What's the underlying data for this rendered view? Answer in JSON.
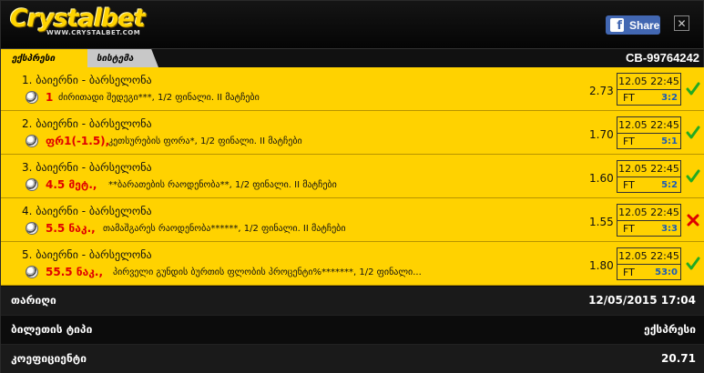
{
  "header": {
    "logo_text": "Crystalbet",
    "logo_sub": "WWW.CRYSTALBET.COM",
    "share_icon": "f",
    "share_label": "Share",
    "close_symbol": "✕"
  },
  "tabs": {
    "express_label": "ექსპრესი",
    "system_label": "სისტემა",
    "ticket_id": "CB-99764242"
  },
  "colors": {
    "accent": "#ffd200",
    "pick_red": "#e00000",
    "score_blue": "#1a5cb8",
    "win_green": "#22aa22",
    "loss_red": "#dd0000"
  },
  "bets": [
    {
      "title": "1. ბაიერნი - ბარსელონა",
      "pick": "1",
      "desc": "ძირითადი შედეგი***, 1/2 ფინალი. II მატჩები",
      "odds": "2.73",
      "date": "12.05 22:45",
      "ft": "FT",
      "score": "3:2",
      "status": "won"
    },
    {
      "title": "2. ბაიერნი - ბარსელონა",
      "pick": "ფრ1(-1.5),",
      "desc": "კეთსურების ფორა*, 1/2 ფინალი. II მატჩები",
      "odds": "1.70",
      "date": "12.05 22:45",
      "ft": "FT",
      "score": "5:1",
      "status": "won"
    },
    {
      "title": "3. ბაიერნი - ბარსელონა",
      "pick": "4.5 მეტ.,",
      "desc": "**ბარათების რაოდენობა**, 1/2 ფინალი. II მატჩები",
      "odds": "1.60",
      "date": "12.05 22:45",
      "ft": "FT",
      "score": "5:2",
      "status": "won"
    },
    {
      "title": "4. ბაიერნი - ბარსელონა",
      "pick": "5.5 ნაკ.,",
      "desc": "თამაშგარეს რაოდენობა******, 1/2 ფინალი. II მატჩები",
      "odds": "1.55",
      "date": "12.05 22:45",
      "ft": "FT",
      "score": "3:3",
      "status": "lost"
    },
    {
      "title": "5. ბაიერნი - ბარსელონა",
      "pick": "55.5 ნაკ.,",
      "desc": "პირველი გუნდის ბურთის ფლობის პროცენტი%*******, 1/2 ფინალი...",
      "odds": "1.80",
      "date": "12.05 22:45",
      "ft": "FT",
      "score": "53:0",
      "status": "won"
    }
  ],
  "summary": {
    "date_label": "თარიღი",
    "date_value": "12/05/2015 17:04",
    "type_label": "ბილეთის ტიპი",
    "type_value": "ექსპრესი",
    "coef_label": "კოეფიციენტი",
    "coef_value": "20.71"
  }
}
